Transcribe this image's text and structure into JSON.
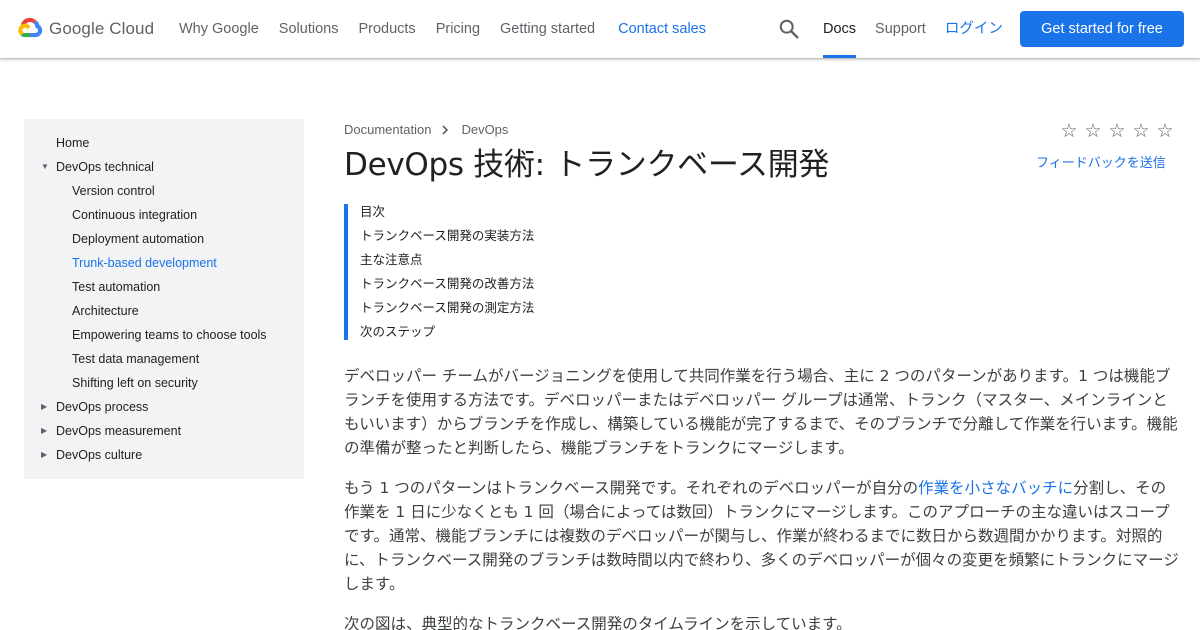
{
  "header": {
    "logo_text": "Google Cloud",
    "nav": [
      "Why Google",
      "Solutions",
      "Products",
      "Pricing",
      "Getting started"
    ],
    "contact_sales": "Contact sales",
    "docs": "Docs",
    "support": "Support",
    "login": "ログイン",
    "cta": "Get started for free"
  },
  "sidebar": {
    "items": [
      {
        "label": "Home",
        "level": 1,
        "arrow": ""
      },
      {
        "label": "DevOps technical",
        "level": 1,
        "arrow": "▼"
      },
      {
        "label": "Version control",
        "level": 2,
        "arrow": ""
      },
      {
        "label": "Continuous integration",
        "level": 2,
        "arrow": ""
      },
      {
        "label": "Deployment automation",
        "level": 2,
        "arrow": ""
      },
      {
        "label": "Trunk-based development",
        "level": 2,
        "arrow": "",
        "active": true
      },
      {
        "label": "Test automation",
        "level": 2,
        "arrow": ""
      },
      {
        "label": "Architecture",
        "level": 2,
        "arrow": ""
      },
      {
        "label": "Empowering teams to choose tools",
        "level": 2,
        "arrow": ""
      },
      {
        "label": "Test data management",
        "level": 2,
        "arrow": ""
      },
      {
        "label": "Shifting left on security",
        "level": 2,
        "arrow": ""
      },
      {
        "label": "DevOps process",
        "level": 1,
        "arrow": "▶"
      },
      {
        "label": "DevOps measurement",
        "level": 1,
        "arrow": "▶"
      },
      {
        "label": "DevOps culture",
        "level": 1,
        "arrow": "▶"
      }
    ]
  },
  "breadcrumb": {
    "items": [
      "Documentation",
      "DevOps"
    ]
  },
  "title": "DevOps 技術: トランクベース開発",
  "rating": {
    "stars": [
      "☆",
      "☆",
      "☆",
      "☆",
      "☆"
    ]
  },
  "feedback": "フィードバックを送信",
  "toc": {
    "heading": "目次",
    "items": [
      "トランクベース開発の実装方法",
      "主な注意点",
      "トランクベース開発の改善方法",
      "トランクベース開発の測定方法",
      "次のステップ"
    ]
  },
  "content": {
    "p1": "デベロッパー チームがバージョニングを使用して共同作業を行う場合、主に 2 つのパターンがあります。1 つは機能ブランチを使用する方法です。デベロッパーまたはデベロッパー グループは通常、トランク（マスター、メインラインともいいます）からブランチを作成し、構築している機能が完了するまで、そのブランチで分離して作業を行います。機能の準備が整ったと判断したら、機能ブランチをトランクにマージします。",
    "p2_before": "もう 1 つのパターンはトランクベース開発です。それぞれのデベロッパーが自分の",
    "p2_link": "作業を小さなバッチに",
    "p2_after": "分割し、その作業を 1 日に少なくとも 1 回（場合によっては数回）トランクにマージします。このアプローチの主な違いはスコープです。通常、機能ブランチには複数のデベロッパーが関与し、作業が終わるまでに数日から数週間かかります。対照的に、トランクベース開発のブランチは数時間以内で終わり、多くのデベロッパーが個々の変更を頻繁にトランクにマージします。",
    "p3": "次の図は、典型的なトランクベース開発のタイムラインを示しています。"
  }
}
